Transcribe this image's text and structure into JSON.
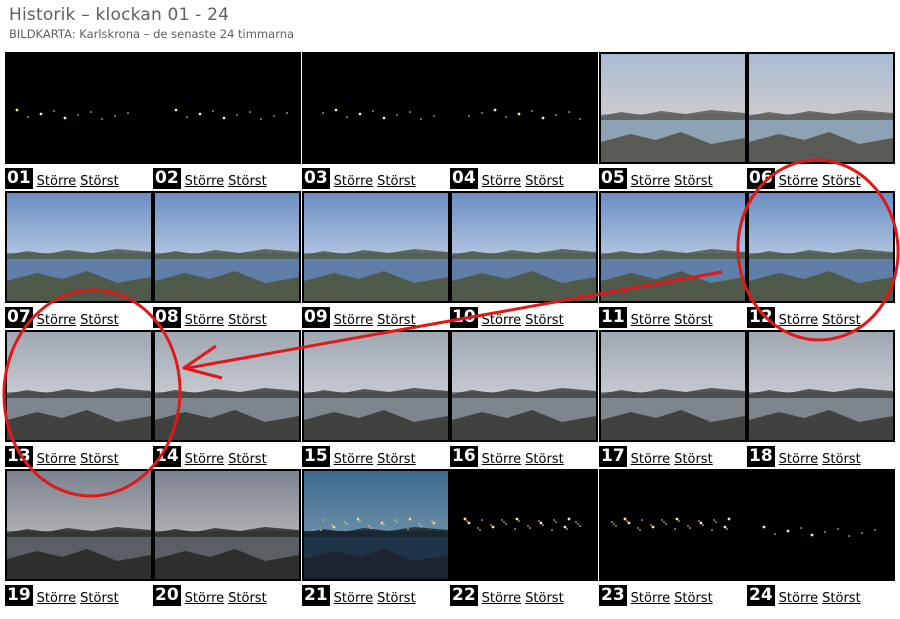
{
  "header": {
    "title": "Historik – klockan 01 - 24",
    "subtitle": "BILDKARTA: Karlskrona – de senaste 24 timmarna"
  },
  "colors": {
    "accent_red": "#e01818",
    "title_gray": "#606060"
  },
  "thumbnails": [
    {
      "hour": "01",
      "larger": "Större",
      "largest": "Störst",
      "scene": "night"
    },
    {
      "hour": "02",
      "larger": "Större",
      "largest": "Störst",
      "scene": "night"
    },
    {
      "hour": "03",
      "larger": "Större",
      "largest": "Störst",
      "scene": "night"
    },
    {
      "hour": "04",
      "larger": "Större",
      "largest": "Störst",
      "scene": "night"
    },
    {
      "hour": "05",
      "larger": "Större",
      "largest": "Störst",
      "scene": "dawn"
    },
    {
      "hour": "06",
      "larger": "Större",
      "largest": "Störst",
      "scene": "dawn"
    },
    {
      "hour": "07",
      "larger": "Större",
      "largest": "Störst",
      "scene": "day"
    },
    {
      "hour": "08",
      "larger": "Större",
      "largest": "Störst",
      "scene": "day"
    },
    {
      "hour": "09",
      "larger": "Större",
      "largest": "Störst",
      "scene": "day"
    },
    {
      "hour": "10",
      "larger": "Större",
      "largest": "Störst",
      "scene": "day"
    },
    {
      "hour": "11",
      "larger": "Större",
      "largest": "Störst",
      "scene": "day"
    },
    {
      "hour": "12",
      "larger": "Större",
      "largest": "Störst",
      "scene": "day"
    },
    {
      "hour": "13",
      "larger": "Större",
      "largest": "Störst",
      "scene": "overcast"
    },
    {
      "hour": "14",
      "larger": "Större",
      "largest": "Störst",
      "scene": "overcast"
    },
    {
      "hour": "15",
      "larger": "Större",
      "largest": "Störst",
      "scene": "overcast"
    },
    {
      "hour": "16",
      "larger": "Större",
      "largest": "Störst",
      "scene": "overcast"
    },
    {
      "hour": "17",
      "larger": "Större",
      "largest": "Störst",
      "scene": "overcast"
    },
    {
      "hour": "18",
      "larger": "Större",
      "largest": "Störst",
      "scene": "overcast"
    },
    {
      "hour": "19",
      "larger": "Större",
      "largest": "Störst",
      "scene": "dusk"
    },
    {
      "hour": "20",
      "larger": "Större",
      "largest": "Störst",
      "scene": "dusk"
    },
    {
      "hour": "21",
      "larger": "Större",
      "largest": "Störst",
      "scene": "twilight"
    },
    {
      "hour": "22",
      "larger": "Större",
      "largest": "Störst",
      "scene": "citynight"
    },
    {
      "hour": "23",
      "larger": "Större",
      "largest": "Störst",
      "scene": "citynight"
    },
    {
      "hour": "24",
      "larger": "Större",
      "largest": "Störst",
      "scene": "night"
    }
  ]
}
